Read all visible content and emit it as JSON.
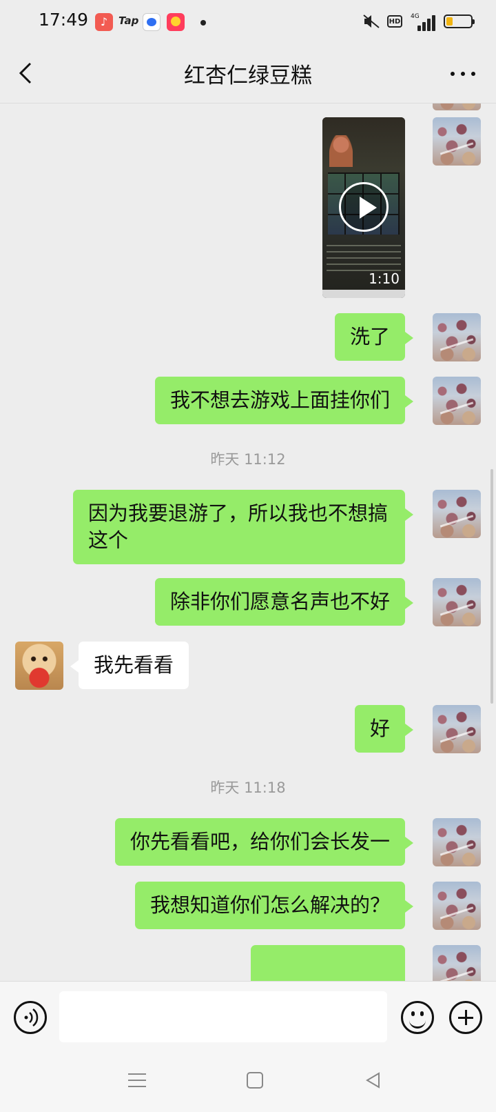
{
  "status_bar": {
    "time": "17:49",
    "tap_label": "Tap",
    "hd_label": "HD",
    "network": "4G",
    "battery_level": 0.25
  },
  "header": {
    "title": "红杏仁绿豆糕"
  },
  "messages": [
    {
      "type": "video",
      "side": "right",
      "duration": "1:10"
    },
    {
      "type": "text",
      "side": "right",
      "text": "洗了"
    },
    {
      "type": "text",
      "side": "right",
      "text": "我不想去游戏上面挂你们"
    },
    {
      "type": "time",
      "text": "昨天 11:12"
    },
    {
      "type": "text",
      "side": "right",
      "text": "因为我要退游了，所以我也不想搞这个"
    },
    {
      "type": "text",
      "side": "right",
      "text": "除非你们愿意名声也不好"
    },
    {
      "type": "text",
      "side": "left",
      "text": "我先看看"
    },
    {
      "type": "text",
      "side": "right",
      "text": "好"
    },
    {
      "type": "time",
      "text": "昨天 11:18"
    },
    {
      "type": "text",
      "side": "right",
      "text": "你先看看吧，给你们会长发一"
    },
    {
      "type": "text",
      "side": "right",
      "text": "我想知道你们怎么解决的？"
    }
  ],
  "input": {
    "value": "",
    "placeholder": ""
  },
  "icons": {
    "back": "chevron-left-icon",
    "more": "more-icon",
    "voice": "voice-icon",
    "emoji": "emoji-icon",
    "plus": "plus-icon"
  },
  "colors": {
    "my_bubble": "#95ec69",
    "other_bubble": "#ffffff",
    "background": "#ededed"
  }
}
